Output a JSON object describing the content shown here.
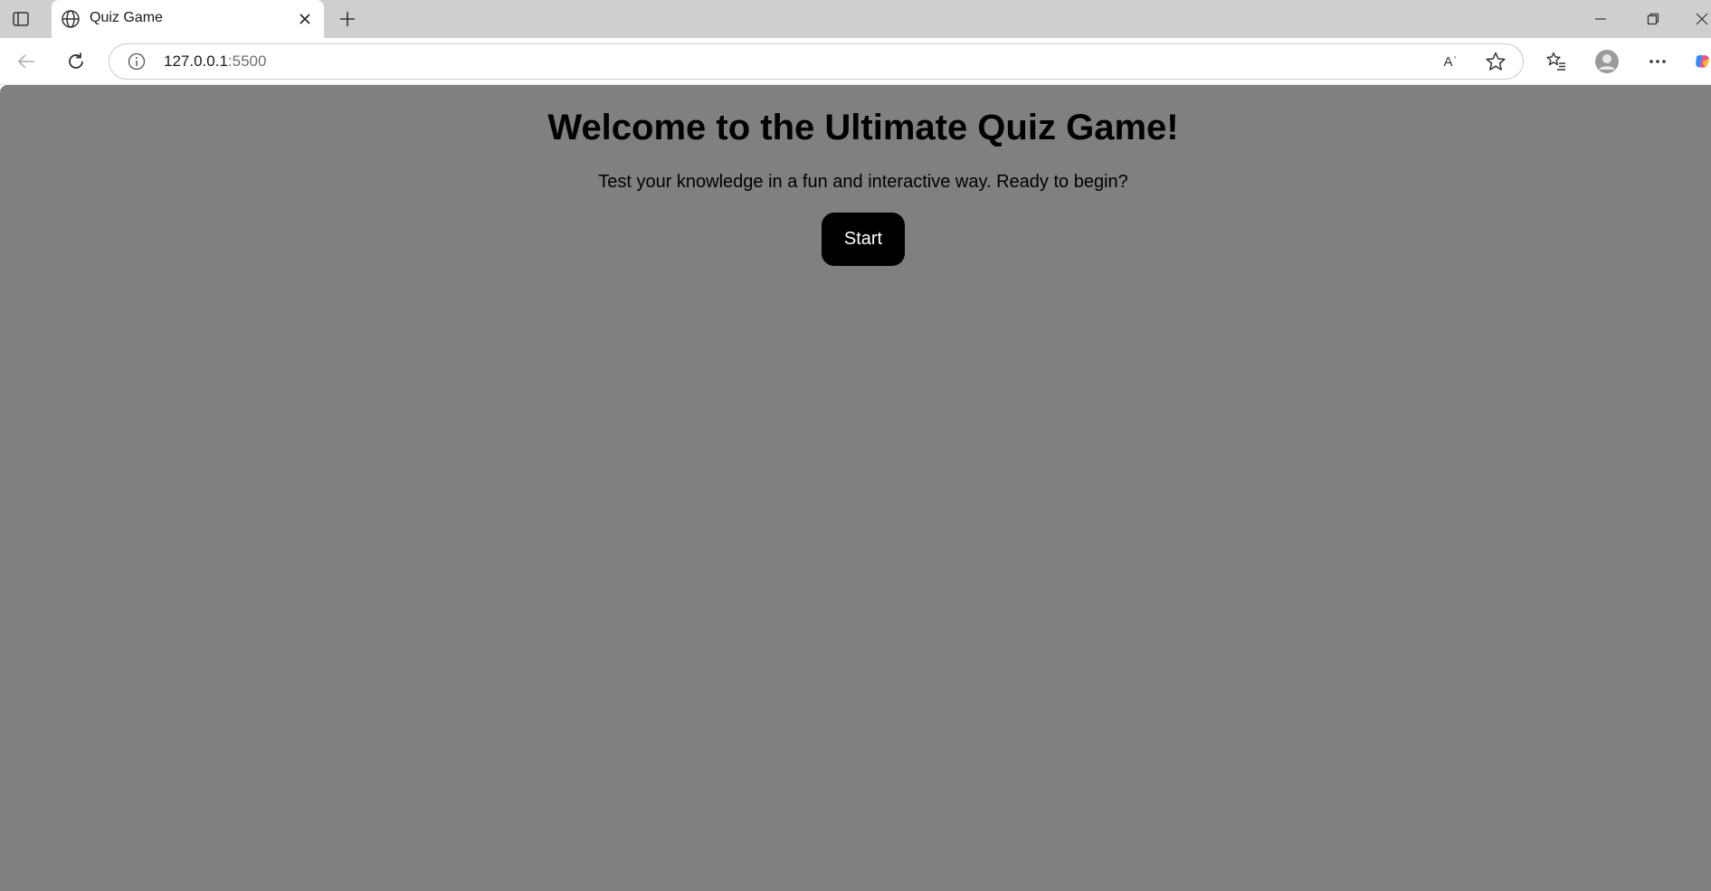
{
  "browser": {
    "tab": {
      "title": "Quiz Game"
    },
    "address_bar": {
      "host": "127.0.0.1",
      "port": ":5500"
    },
    "read_aloud_glyph": "Aʾ"
  },
  "page": {
    "title": "Welcome to the Ultimate Quiz Game!",
    "subtitle": "Test your knowledge in a fun and interactive way. Ready to begin?",
    "start_label": "Start"
  },
  "colors": {
    "page_background": "#808080",
    "button_background": "#000000",
    "button_text": "#ffffff"
  }
}
